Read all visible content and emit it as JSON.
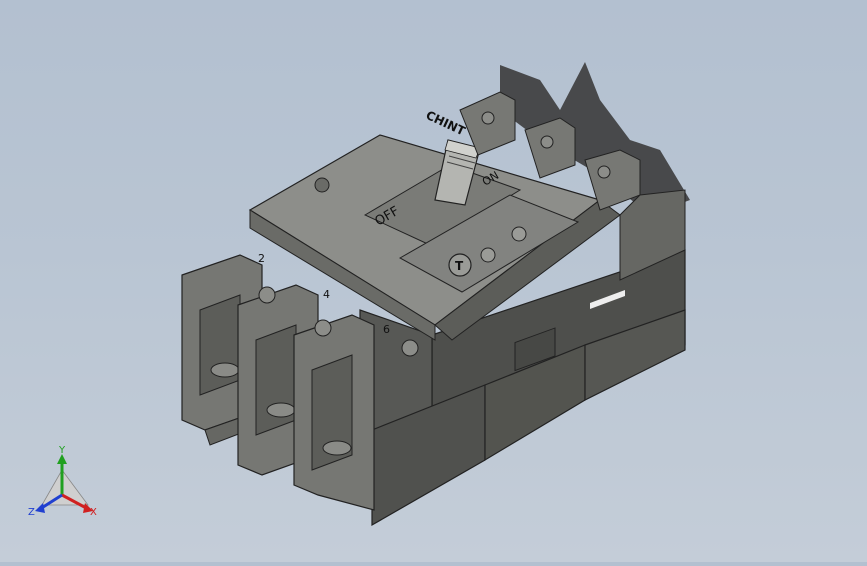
{
  "brand_text": "CHINT",
  "handle_on_label": "ON",
  "handle_off_label": "OFF",
  "terminal_labels": [
    "2",
    "4",
    "6"
  ],
  "test_button_label": "T",
  "triad": {
    "x_label": "X",
    "y_label": "Y",
    "z_label": "Z"
  },
  "colors": {
    "background": "#b9c5d3",
    "body_face": "#5a5b58",
    "body_top": "#8b8c88",
    "shadow": "#3a3a3a",
    "axis_x": "#d02020",
    "axis_y": "#20a020",
    "axis_z": "#2040d0"
  }
}
